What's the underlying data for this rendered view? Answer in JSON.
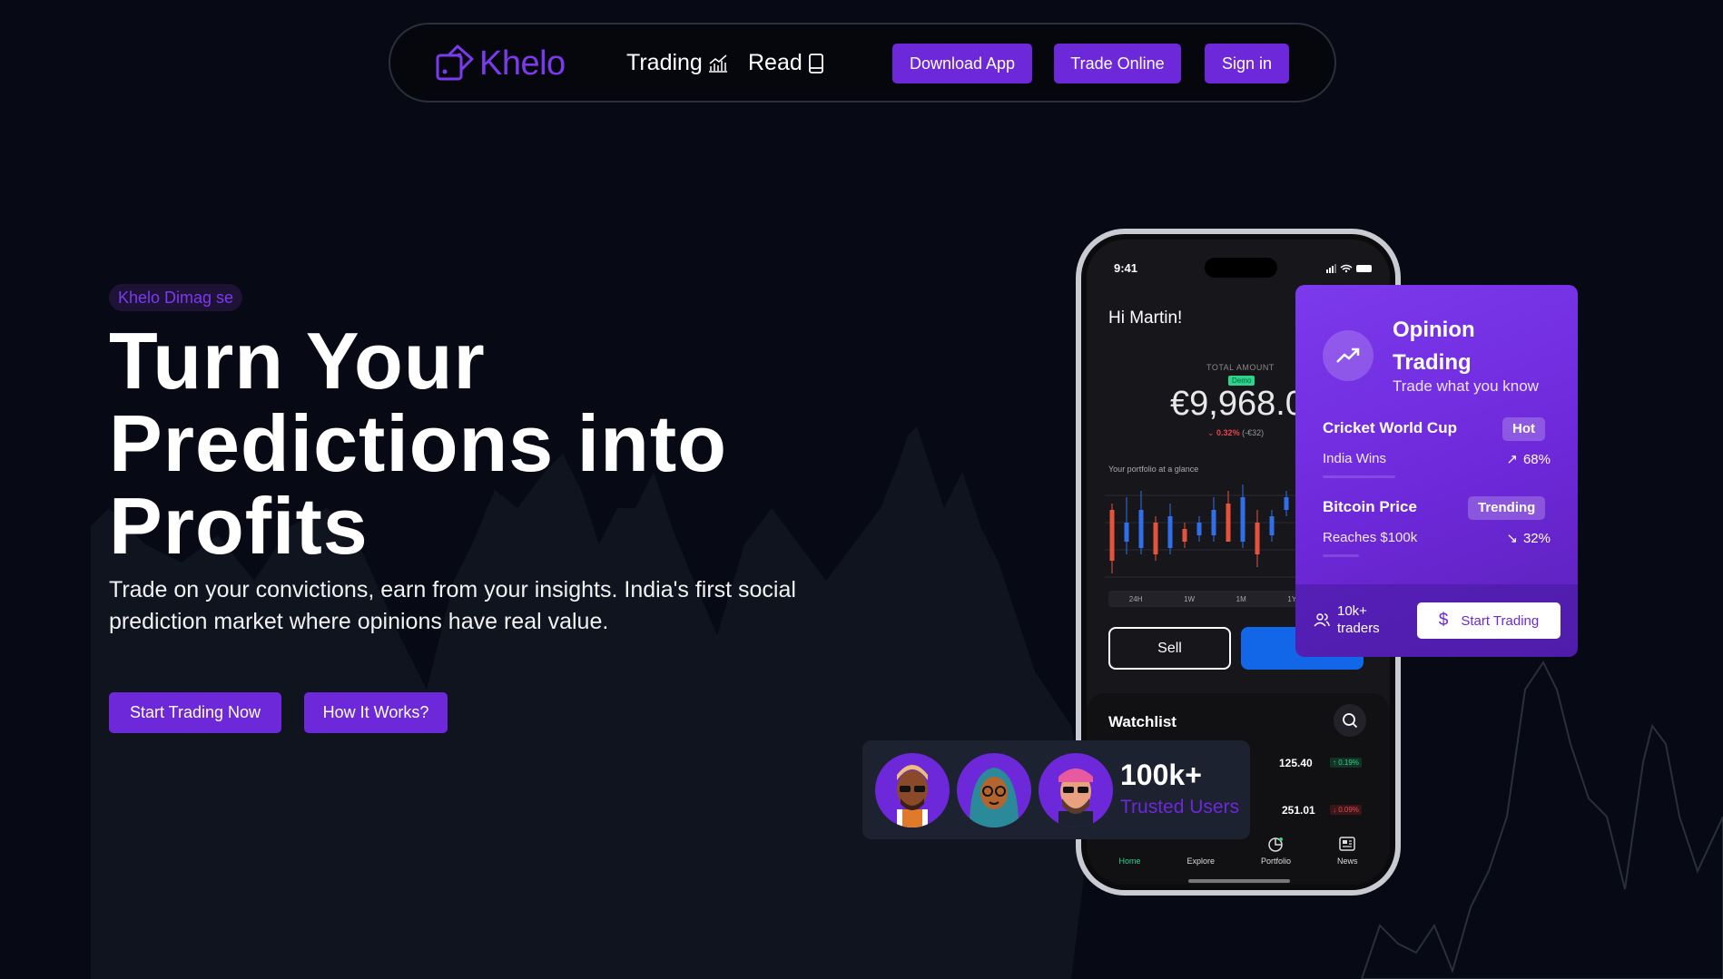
{
  "nav": {
    "brand": "Khelo",
    "links": [
      {
        "label": "Trading"
      },
      {
        "label": "Read"
      }
    ],
    "buttons": {
      "download": "Download App",
      "trade_online": "Trade Online",
      "sign_in": "Sign in"
    }
  },
  "hero": {
    "tagline": "Khelo Dimag se",
    "title_lines": [
      "Turn Your",
      "Predictions into",
      "Profits"
    ],
    "subtitle": "Trade on your convictions, earn from your insights. India's first social prediction market where opinions have real value.",
    "cta_primary": "Start Trading Now",
    "cta_secondary": "How It Works?"
  },
  "phone": {
    "time": "9:41",
    "greeting": "Hi Martin!",
    "total_label": "TOTAL AMOUNT",
    "demo_badge": "Demo",
    "amount": "€9,968.0",
    "delta_pct": "0.32%",
    "delta_abs": "(-€32)",
    "glance_label": "Your portfolio at a glance",
    "ranges": [
      "24H",
      "1W",
      "1M",
      "1Y"
    ],
    "sell_label": "Sell",
    "watchlist_title": "Watchlist",
    "watchlist": [
      {
        "price": "125.40",
        "change": "↑ 0.19%",
        "direction": "up"
      },
      {
        "price": "251.01",
        "change": "↓ 0.09%",
        "direction": "down"
      }
    ],
    "tabs": [
      {
        "label": "Home",
        "icon": "home-icon",
        "active": true
      },
      {
        "label": "Explore",
        "icon": "explore-icon",
        "active": false
      },
      {
        "label": "Portfolio",
        "icon": "portfolio-icon",
        "active": false
      },
      {
        "label": "News",
        "icon": "news-icon",
        "active": false
      }
    ],
    "candles": [
      {
        "o": 4,
        "c": 12,
        "h": 3,
        "l": 14,
        "up": false
      },
      {
        "o": 9,
        "c": 6,
        "h": 2,
        "l": 11,
        "up": true
      },
      {
        "o": 10,
        "c": 4,
        "h": 1,
        "l": 11,
        "up": true
      },
      {
        "o": 6,
        "c": 11,
        "h": 5,
        "l": 12,
        "up": false
      },
      {
        "o": 10,
        "c": 5,
        "h": 3,
        "l": 11,
        "up": true
      },
      {
        "o": 7,
        "c": 9,
        "h": 6,
        "l": 10,
        "up": false
      },
      {
        "o": 8,
        "c": 6,
        "h": 5,
        "l": 9,
        "up": true
      },
      {
        "o": 8,
        "c": 4,
        "h": 2,
        "l": 9,
        "up": true
      },
      {
        "o": 3,
        "c": 9,
        "h": 1,
        "l": 9,
        "up": false
      },
      {
        "o": 9,
        "c": 2,
        "h": 0,
        "l": 10,
        "up": true
      },
      {
        "o": 6,
        "c": 11,
        "h": 4,
        "l": 13,
        "up": false
      },
      {
        "o": 8,
        "c": 5,
        "h": 4,
        "l": 9,
        "up": true
      },
      {
        "o": 4,
        "c": 2,
        "h": 1,
        "l": 5,
        "up": true
      }
    ]
  },
  "opinion": {
    "title": "Opinion Trading",
    "subtitle": "Trade what you know",
    "items": [
      {
        "title": "Cricket World Cup",
        "badge": "Hot",
        "outcome": "India Wins",
        "arrow": "↗",
        "value": "68%"
      },
      {
        "title": "Bitcoin Price",
        "badge": "Trending",
        "outcome": "Reaches $100k",
        "arrow": "↘",
        "value": "32%"
      }
    ],
    "traders": "10k+ traders",
    "start": "Start Trading"
  },
  "trusted": {
    "count": "100k+",
    "label": "Trusted Users"
  },
  "colors": {
    "accent": "#6d28d9",
    "bg": "#070a14",
    "up": "#2f6fe8",
    "down": "#e5533d"
  }
}
